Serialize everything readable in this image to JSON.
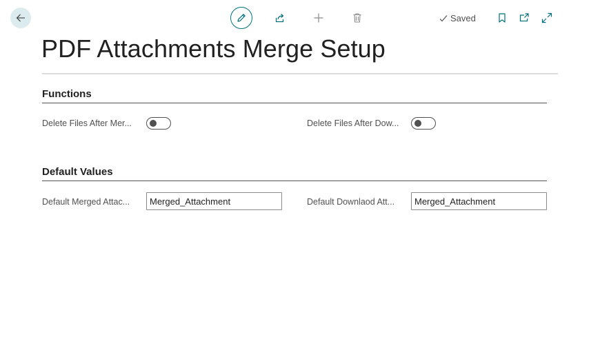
{
  "toolbar": {
    "back_icon": "arrow-left-icon",
    "edit_icon": "pencil-icon",
    "share_icon": "share-icon",
    "new_icon": "plus-icon",
    "delete_icon": "trash-icon",
    "saved_status": "Saved",
    "bookmark_icon": "bookmark-icon",
    "open_new_window_icon": "open-in-new-window-icon",
    "expand_icon": "expand-icon"
  },
  "page": {
    "title": "PDF Attachments Merge Setup"
  },
  "sections": {
    "functions": {
      "title": "Functions",
      "delete_after_merge_label": "Delete Files After Mer...",
      "delete_after_merge_value": false,
      "delete_after_download_label": "Delete Files After Dow...",
      "delete_after_download_value": false
    },
    "default_values": {
      "title": "Default Values",
      "merged_attachment_label": "Default Merged Attac...",
      "merged_attachment_value": "Merged_Attachment",
      "download_attachment_label": "Default Downlaod Att...",
      "download_attachment_value": "Merged_Attachment"
    }
  },
  "colors": {
    "accent": "#00707a",
    "back_button_bg": "#dcebee",
    "toolbar_icon": "#505050"
  }
}
